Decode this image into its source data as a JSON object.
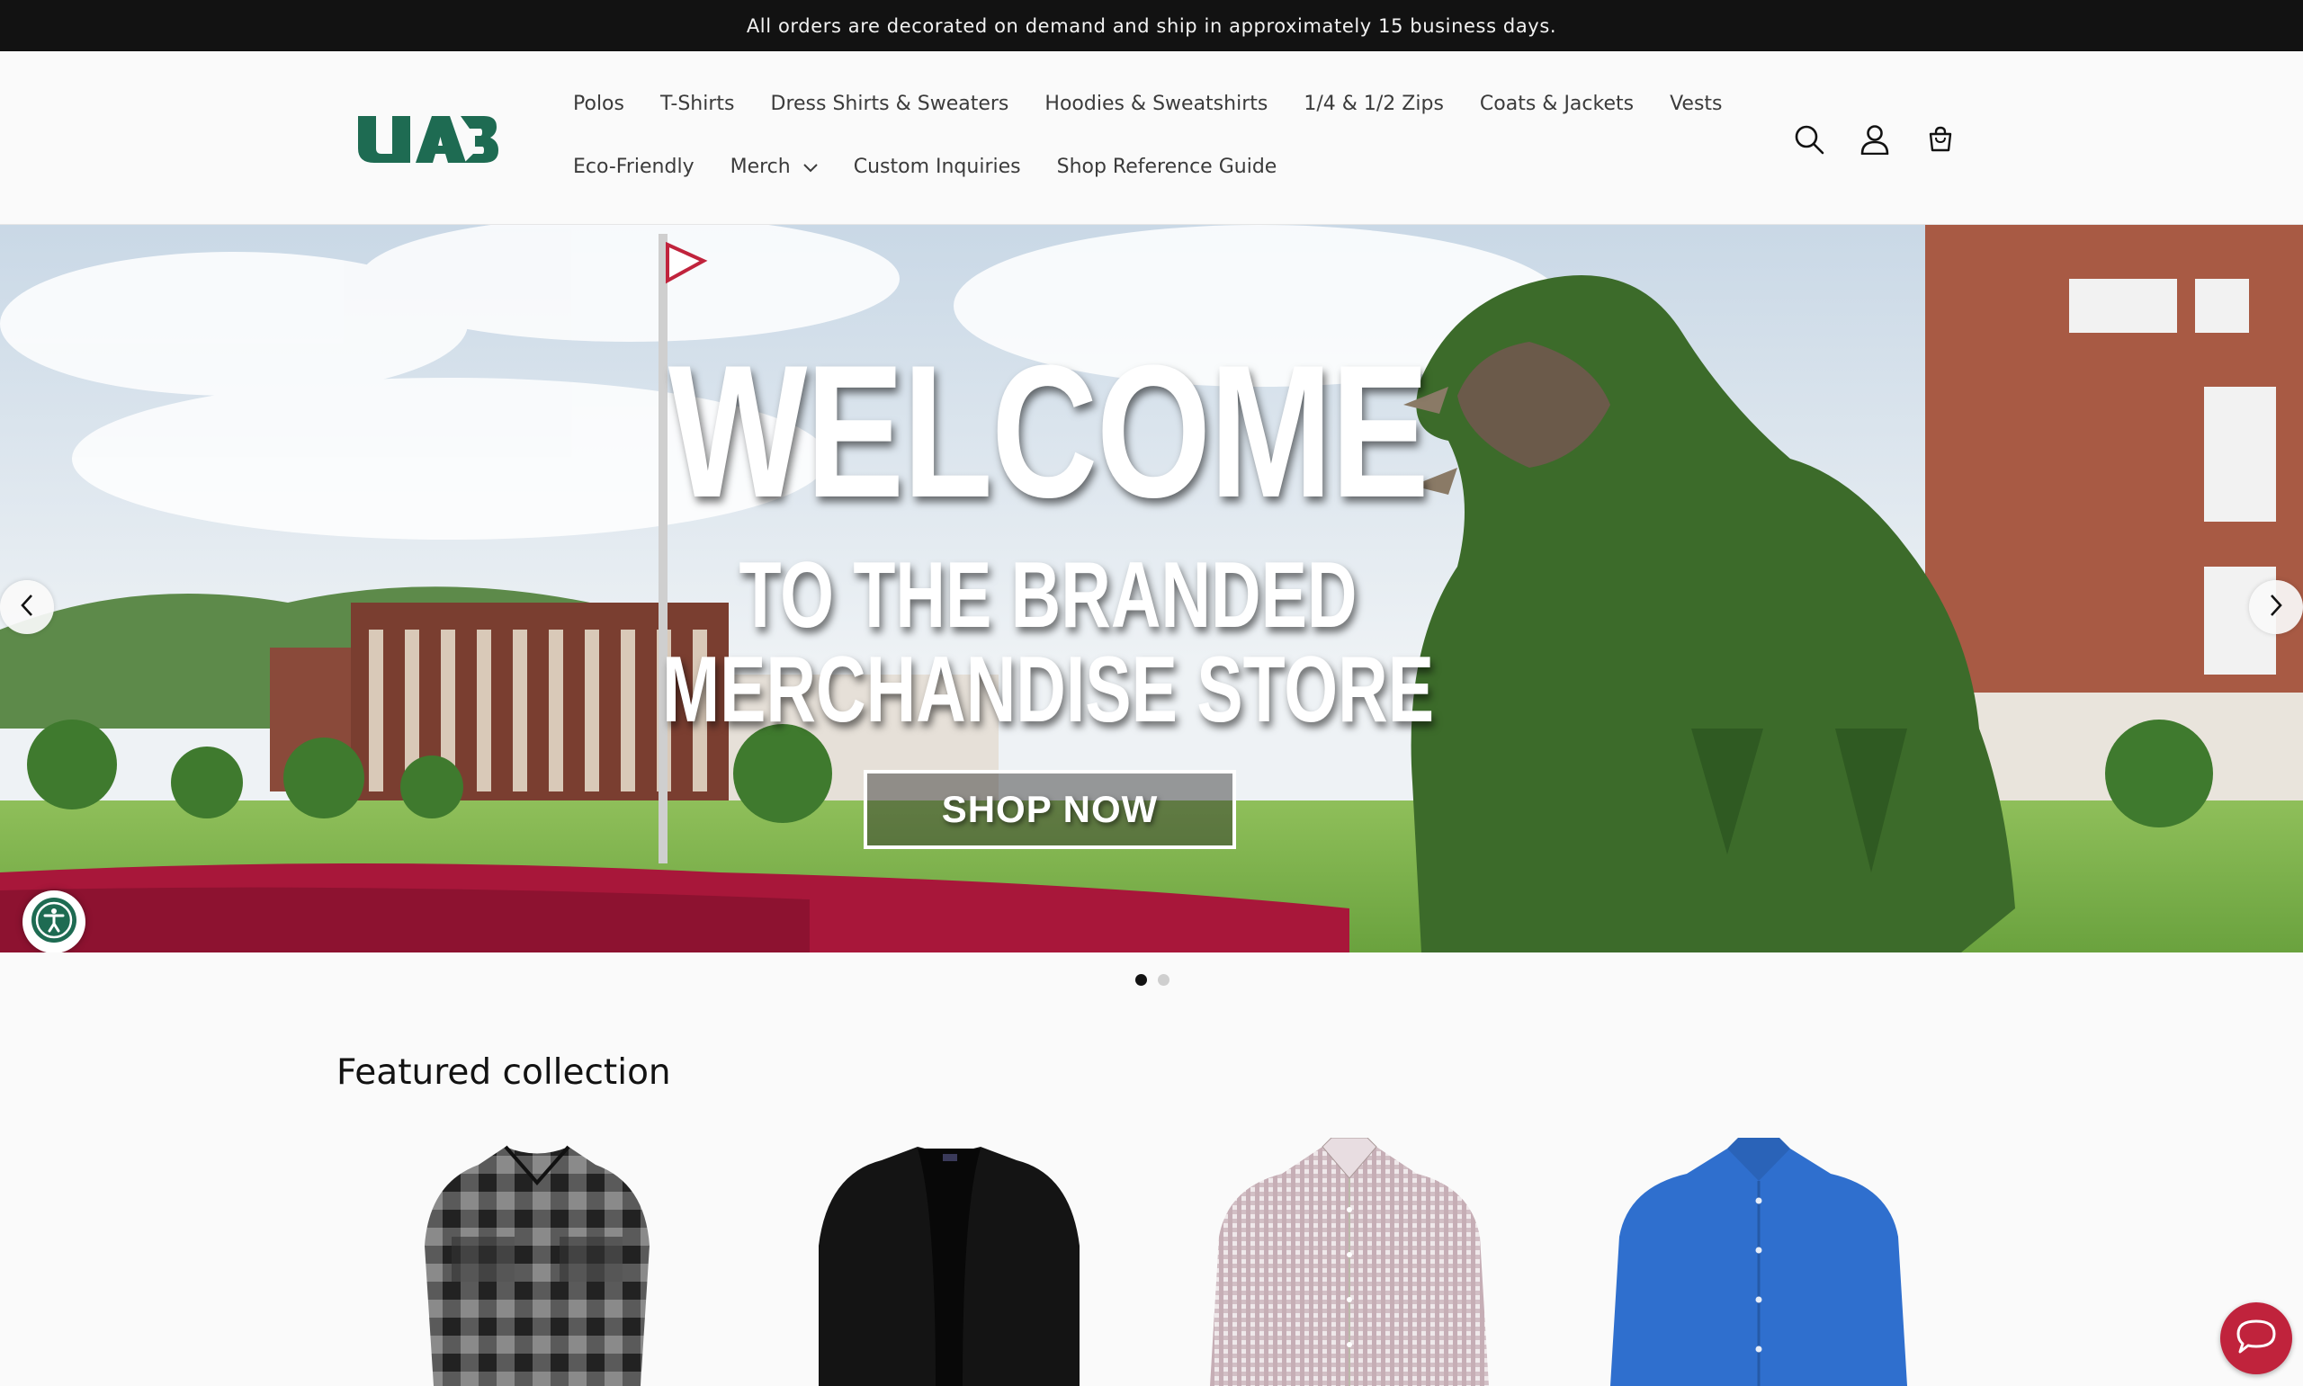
{
  "announcement": "All orders are decorated on demand and ship in approximately 15 business days.",
  "logo_text": "UAB",
  "brand_color": "#1e6b52",
  "nav": {
    "row1": [
      "Polos",
      "T-Shirts",
      "Dress Shirts & Sweaters",
      "Hoodies & Sweatshirts",
      "1/4 & 1/2 Zips",
      "Coats & Jackets",
      "Vests"
    ],
    "row2": [
      "Eco-Friendly",
      "Merch",
      "Custom Inquiries",
      "Shop Reference Guide"
    ],
    "merch_has_dropdown": true
  },
  "header_icons": [
    "search-icon",
    "account-icon",
    "cart-icon"
  ],
  "hero": {
    "title": "WELCOME",
    "subtitle_line1": "TO THE BRANDED",
    "subtitle_line2": "MERCHANDISE STORE",
    "button": "SHOP NOW",
    "slide_count": 2,
    "active_slide": 1
  },
  "featured": {
    "heading": "Featured collection",
    "products": [
      {
        "image": "plaid-flannel-shirt",
        "color": "#3a3a3a"
      },
      {
        "image": "black-cardigan",
        "color": "#141414"
      },
      {
        "image": "checked-dress-shirt",
        "color": "#d8c9cf"
      },
      {
        "image": "blue-dress-shirt",
        "color": "#2f6fce"
      }
    ]
  },
  "widgets": [
    "accessibility-icon",
    "chat-icon"
  ]
}
